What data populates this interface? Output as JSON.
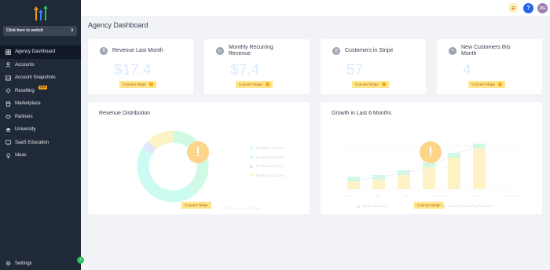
{
  "sidebar": {
    "switcher_label": "Click here to switch",
    "items": [
      {
        "label": "Agency Dashboard",
        "icon": "dashboard-icon",
        "active": true
      },
      {
        "label": "Accounts",
        "icon": "user-icon"
      },
      {
        "label": "Account Snapshots",
        "icon": "snapshot-icon"
      },
      {
        "label": "Reselling",
        "icon": "reselling-icon",
        "badge": "New"
      },
      {
        "label": "Marketplace",
        "icon": "marketplace-icon"
      },
      {
        "label": "Partners",
        "icon": "partners-icon"
      },
      {
        "label": "University",
        "icon": "university-icon"
      },
      {
        "label": "SaaS Education",
        "icon": "saas-education-icon"
      },
      {
        "label": "Ideas",
        "icon": "lightbulb-icon"
      }
    ],
    "settings_label": "Settings",
    "collapse_glyph": "‹"
  },
  "topbar": {
    "avatar_initials": "ZG",
    "help_glyph": "?"
  },
  "page": {
    "title": "Agency Dashboard"
  },
  "stats": [
    {
      "title": "Revenue Last Month",
      "value": "$17.4",
      "icon": "dollar-icon"
    },
    {
      "title": "Monthly Recurring Revenue",
      "value": "$7.4",
      "icon": "recurring-icon"
    },
    {
      "title": "Customers in Stripe",
      "value": "57",
      "icon": "customers-icon"
    },
    {
      "title": "New Customers this Month",
      "value": "4",
      "icon": "new-customer-icon"
    }
  ],
  "connect_label": "Connect Stripe",
  "warn_glyph": "!",
  "revenue_distribution": {
    "title": "Revenue Distribution",
    "legend": [
      "Product 1 (38.3%)",
      "Product 2 (45.3%)",
      "Product 3 (4.1%)",
      "Product 4 (12.3%)"
    ],
    "footnote": "Why am I seeing this?"
  },
  "growth": {
    "title": "Growth in Last 6 Months",
    "legend": [
      "New customers",
      "Monthly Recurring Revenue"
    ],
    "months": [
      "Feb",
      "Mar",
      "April",
      "December",
      "January",
      "December"
    ]
  },
  "chart_data": [
    {
      "type": "pie",
      "title": "Revenue Distribution",
      "labels": [
        "Product 1",
        "Product 2",
        "Product 3",
        "Product 4"
      ],
      "values": [
        38.3,
        45.3,
        4.1,
        12.3
      ]
    }
  ],
  "colors": {
    "sidebar": "#1f2937",
    "accent": "#f59e0b",
    "connect_bg": "#fde68a",
    "help": "#2563eb"
  }
}
